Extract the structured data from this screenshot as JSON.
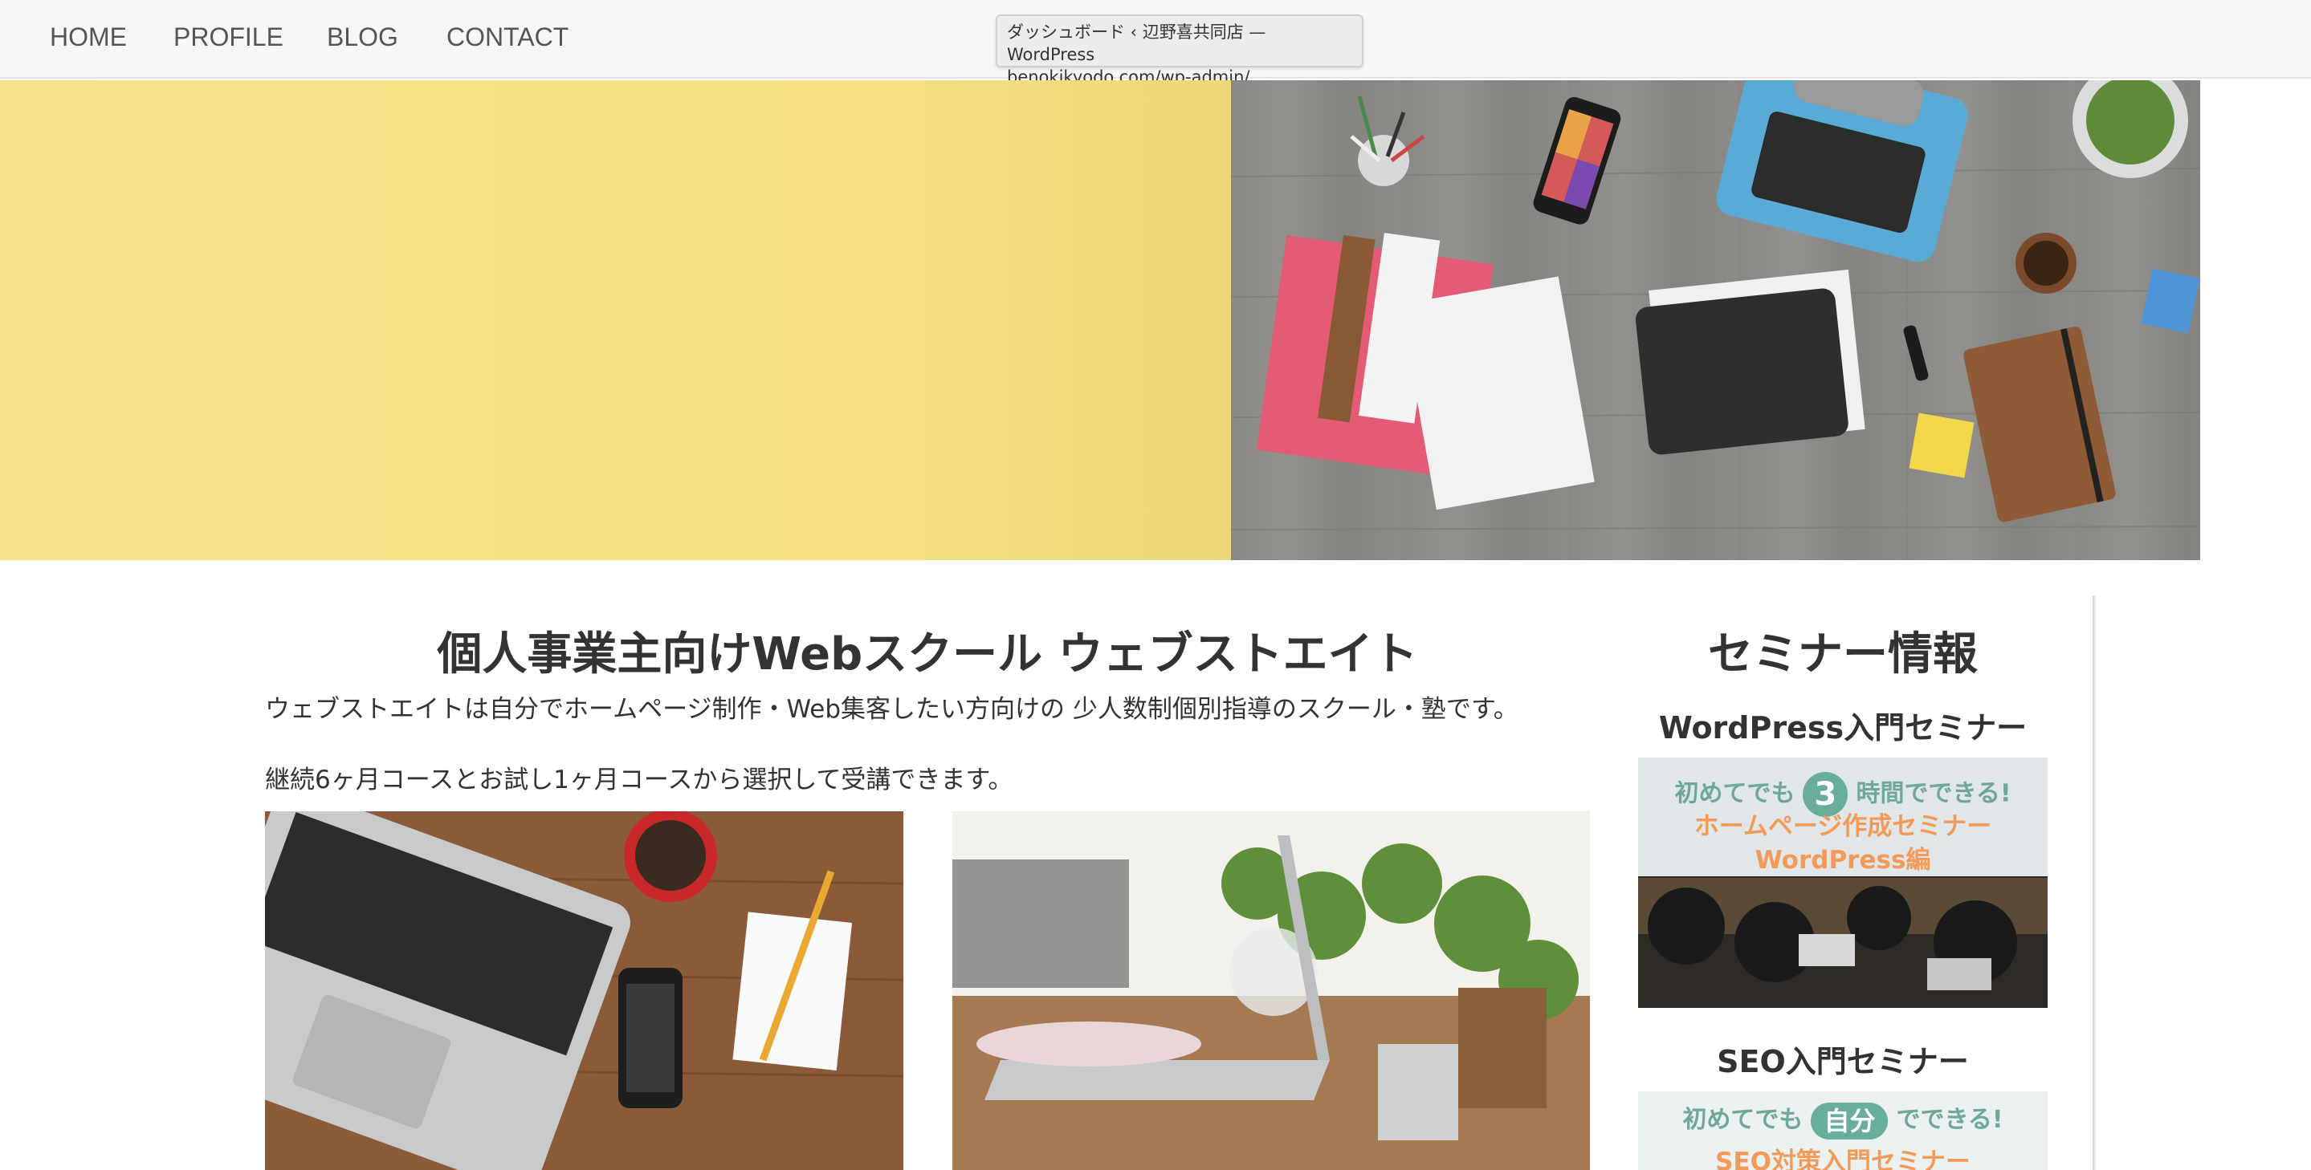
{
  "nav": {
    "items": [
      "HOME",
      "PROFILE",
      "BLOG",
      "CONTACT"
    ]
  },
  "tooltip": {
    "title": "ダッシュボード ‹ 辺野喜共同店 — WordPress",
    "url": "benokikyodo.com/wp-admin/"
  },
  "main": {
    "title": "個人事業主向けWebスクール ウェブストエイト",
    "intro": "ウェブストエイトは自分でホームページ制作・Web集客したい方向けの 少人数制個別指導のスクール・塾です。",
    "courses": "継続6ヶ月コースとお試し1ヶ月コースから選択して受講できます。"
  },
  "sidebar": {
    "title": "セミナー情報",
    "seminars": [
      {
        "heading": "WordPress入門セミナー",
        "banner": {
          "pre": "初めてでも",
          "highlight": "3",
          "post": "時間でできる!",
          "line2": "ホームページ作成セミナー",
          "line3": "WordPress編"
        }
      },
      {
        "heading": "SEO入門セミナー",
        "banner": {
          "pre": "初めてでも",
          "highlight": "自分",
          "post": "でできる!",
          "line2": "SEO対策入門セミナー"
        }
      }
    ]
  },
  "colors": {
    "hero_yellow": "#f5e184",
    "accent_green": "#69ad9c",
    "accent_orange": "#f39a58"
  }
}
